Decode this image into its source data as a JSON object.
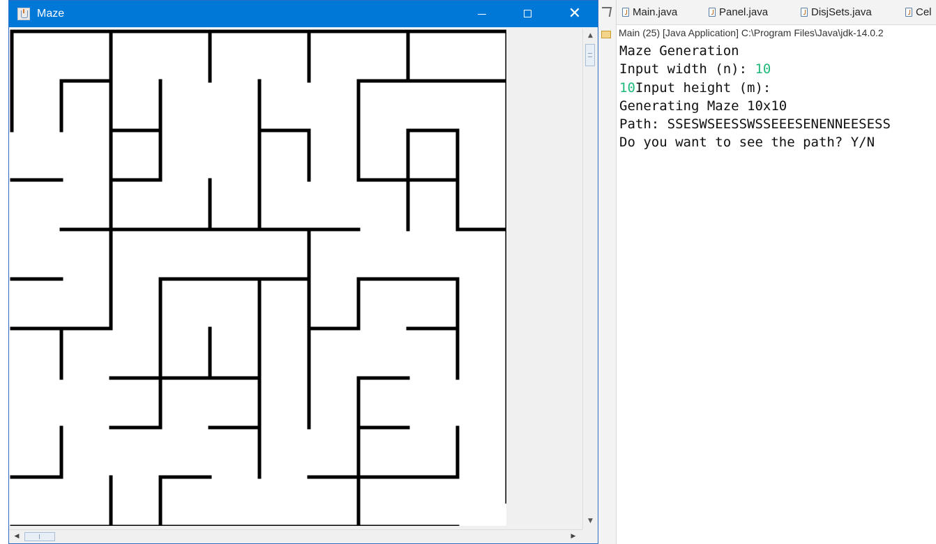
{
  "maze_window": {
    "title": "Maze",
    "app_icon": "java-cup-icon",
    "minimize_icon": "minimize-icon",
    "maximize_icon": "maximize-icon",
    "close_icon": "close-icon",
    "close_symbol": "✕",
    "grid": {
      "cols": 10,
      "rows": 10,
      "colors": {
        "wall": "#000000",
        "background": "#ffffff"
      }
    },
    "scrollbars": {
      "up_symbol": "▲",
      "down_symbol": "▼",
      "left_symbol": "◀",
      "right_symbol": "▶"
    }
  },
  "ide": {
    "tabs": [
      {
        "label": "Main.java",
        "icon": "java-file-icon"
      },
      {
        "label": "Panel.java",
        "icon": "java-file-icon"
      },
      {
        "label": "DisjSets.java",
        "icon": "java-file-icon"
      },
      {
        "label": "Cel",
        "icon": "java-file-icon"
      }
    ],
    "console_header": "Main (25) [Java Application] C:\\Program Files\\Java\\jdk-14.0.2",
    "console": {
      "line1": "Maze Generation",
      "line2_prompt": "Input width (n): ",
      "line2_input": "10",
      "line3_input": "10",
      "line3_prompt": "Input height (m):",
      "line4": "Generating Maze 10x10",
      "line5": "Path: SSESWSEESSWSSEEESENENNEESESS",
      "line6": "Do you want to see the path? Y/N"
    },
    "colors": {
      "user_input": "#1fb97a",
      "title_bar": "#0078d7"
    }
  }
}
